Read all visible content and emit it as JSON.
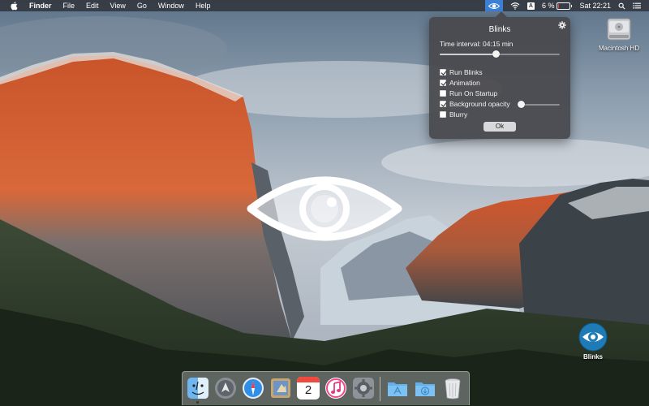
{
  "menubar": {
    "app_name": "Finder",
    "menus": [
      "File",
      "Edit",
      "View",
      "Go",
      "Window",
      "Help"
    ],
    "status": {
      "battery_percent": "6 %",
      "battery_level": 0.06,
      "keyboard_badge": "A",
      "clock": "Sat 22:21",
      "icons": [
        "blinks-eye-icon",
        "wifi-icon",
        "keyboard-input-icon",
        "battery-icon",
        "search-icon",
        "list-icon"
      ]
    }
  },
  "popover": {
    "title": "Blinks",
    "time_interval": "Time interval: 04:15 min",
    "interval_slider_level": 0.47,
    "options": [
      {
        "label": "Run Blinks",
        "checked": true
      },
      {
        "label": "Animation",
        "checked": true
      },
      {
        "label": "Run On Startup",
        "checked": false
      },
      {
        "label": "Background opacity",
        "checked": true
      },
      {
        "label": "Blurry",
        "checked": false
      }
    ],
    "opacity_slider_level": 0.02,
    "ok_label": "Ok"
  },
  "desktop": {
    "disk_label": "Macintosh HD",
    "app_label": "Blinks"
  },
  "dock": {
    "items": [
      "finder-icon",
      "launchpad-icon",
      "safari-icon",
      "mail-icon",
      "calendar-icon",
      "itunes-icon",
      "system-preferences-icon",
      "applications-folder-icon",
      "downloads-folder-icon",
      "trash-icon"
    ],
    "calendar_day": "2"
  },
  "colors": {
    "menubar_highlight": "#3b7fd6",
    "popover_bg": "#48484c",
    "eye_blue": "#1f7bb6"
  }
}
